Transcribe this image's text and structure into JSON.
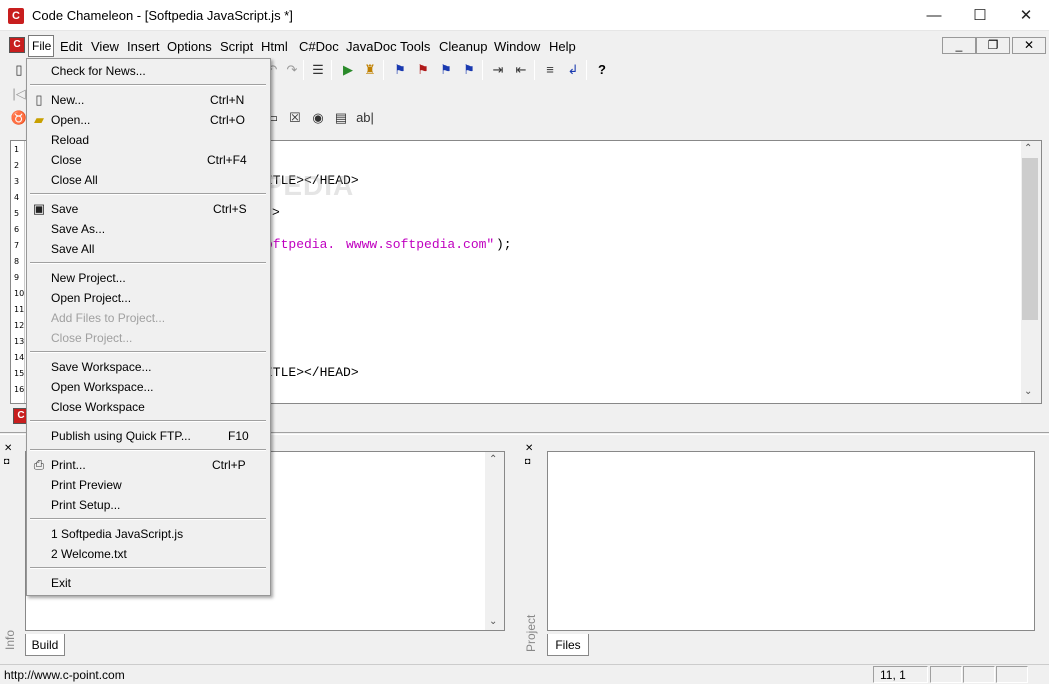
{
  "window": {
    "title": "Code Chameleon - [Softpedia JavaScript.js *]",
    "minimize_glyph": "—",
    "maximize_glyph": "☐",
    "close_glyph": "✕"
  },
  "menubar": {
    "items": [
      "File",
      "Edit",
      "View",
      "Insert",
      "Options",
      "Script",
      "Html",
      "C#Doc",
      "JavaDoc",
      "Tools",
      "Cleanup",
      "Window",
      "Help"
    ],
    "mdi_minimize": "_",
    "mdi_restore": "❐",
    "mdi_close": "✕"
  },
  "toolbar_row3": {
    "checkbox_label": "☒",
    "radio_label": "◉",
    "list_label": "▤",
    "textfield_label": "ab|"
  },
  "editor": {
    "line_numbers": [
      "1",
      "2",
      "3",
      "4",
      "5",
      "6",
      "7",
      "8",
      "9",
      "10",
      "11",
      "12",
      "13",
      "14",
      "15",
      "16"
    ],
    "visible_code": {
      "line3": "ITLE></HEAD>",
      "line5": ">",
      "line7_a": "oftpedia. ",
      "line7_b": "wwww.softpedia.com\"",
      "line7_c": ");",
      "line15": "ITLE></HEAD>"
    },
    "watermark": "SOFTPEDIA",
    "colors": {
      "string": "#c000c0"
    }
  },
  "panes": {
    "left": {
      "tab": "Build",
      "side_label": "Info"
    },
    "right": {
      "tab": "Files",
      "side_label": "Project"
    }
  },
  "file_menu": {
    "check_news": "Check for News...",
    "new": "New...",
    "new_short": "Ctrl+N",
    "open": "Open...",
    "open_short": "Ctrl+O",
    "reload": "Reload",
    "close": "Close",
    "close_short": "Ctrl+F4",
    "close_all": "Close All",
    "save": "Save",
    "save_short": "Ctrl+S",
    "save_as": "Save As...",
    "save_all": "Save All",
    "new_project": "New Project...",
    "open_project": "Open Project...",
    "add_files": "Add Files to Project...",
    "close_project": "Close Project...",
    "save_workspace": "Save Workspace...",
    "open_workspace": "Open Workspace...",
    "close_workspace": "Close Workspace",
    "publish": "Publish using Quick FTP...",
    "publish_short": "F10",
    "print": "Print...",
    "print_short": "Ctrl+P",
    "print_preview": "Print Preview",
    "print_setup": "Print Setup...",
    "recent1": "1 Softpedia JavaScript.js",
    "recent2": "2 Welcome.txt",
    "exit": "Exit"
  },
  "statusbar": {
    "url": "http://www.c-point.com",
    "position": "11, 1"
  }
}
